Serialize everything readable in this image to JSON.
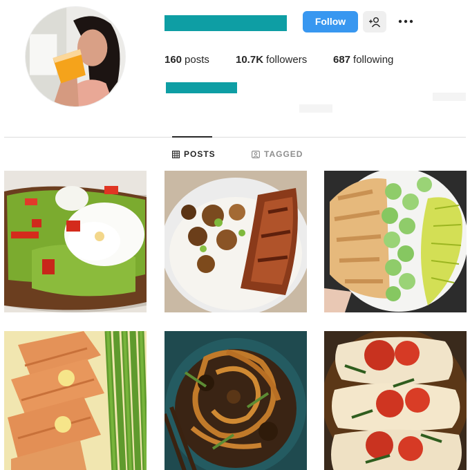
{
  "header": {
    "follow_label": "Follow",
    "suggest_icon": "add-person-icon",
    "more_icon": "more-dots-icon"
  },
  "stats": {
    "posts_count": "160",
    "posts_label": "posts",
    "followers_count": "10.7K",
    "followers_label": "followers",
    "following_count": "687",
    "following_label": "following"
  },
  "tabs": [
    {
      "label": "POSTS",
      "icon": "grid-icon",
      "active": true
    },
    {
      "label": "TAGGED",
      "icon": "tag-icon",
      "active": false
    }
  ],
  "colors": {
    "accent": "#3897f0",
    "redaction": "#0e9ea4"
  }
}
